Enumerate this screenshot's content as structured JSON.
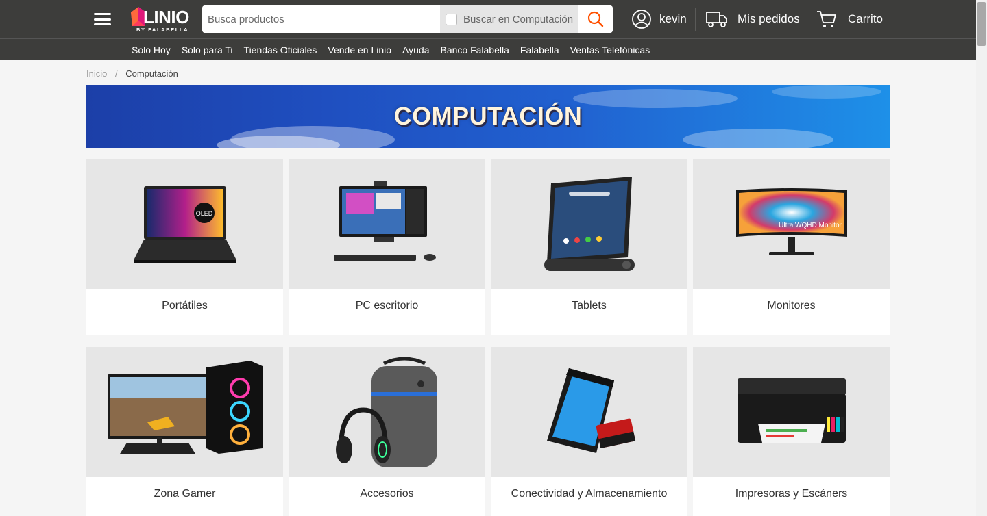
{
  "header": {
    "logo_text": "LINIO",
    "logo_subtext": "BY FALABELLA",
    "search": {
      "placeholder": "Busca productos",
      "value": "",
      "scope_label": "Buscar en Computación"
    },
    "user_name": "kevin",
    "orders_label": "Mis pedidos",
    "cart_label": "Carrito"
  },
  "nav": {
    "items": [
      "Solo Hoy",
      "Solo para Ti",
      "Tiendas Oficiales",
      "Vende en Linio",
      "Ayuda",
      "Banco Falabella",
      "Falabella",
      "Ventas Telefónicas"
    ]
  },
  "breadcrumb": {
    "home": "Inicio",
    "separator": "/",
    "current": "Computación"
  },
  "banner": {
    "title": "COMPUTACIÓN"
  },
  "categories": [
    {
      "label": "Portátiles",
      "icon": "laptop-icon"
    },
    {
      "label": "PC escritorio",
      "icon": "desktop-pc-icon"
    },
    {
      "label": "Tablets",
      "icon": "tablet-icon"
    },
    {
      "label": "Monitores",
      "icon": "monitor-icon"
    },
    {
      "label": "Zona Gamer",
      "icon": "gaming-pc-icon"
    },
    {
      "label": "Accesorios",
      "icon": "backpack-headset-icon"
    },
    {
      "label": "Conectividad y Almacenamiento",
      "icon": "external-drive-icon"
    },
    {
      "label": "Impresoras y Escáners",
      "icon": "printer-icon"
    }
  ],
  "colors": {
    "header_bg": "#3d3d3b",
    "accent": "#ff5000",
    "card_image_bg": "#e6e6e6",
    "page_bg": "#f5f5f5"
  }
}
